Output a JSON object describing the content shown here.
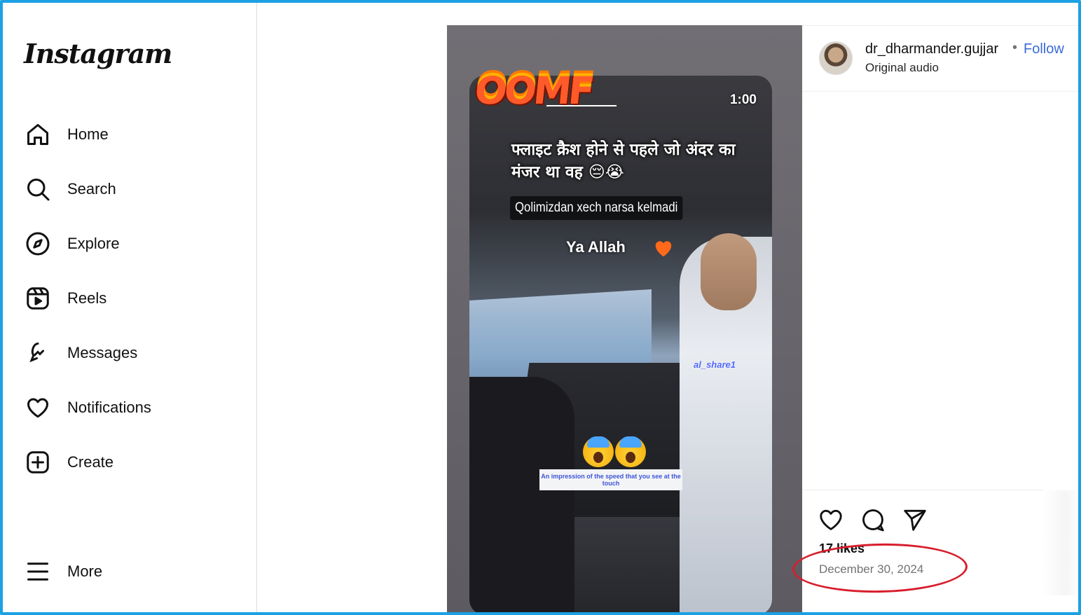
{
  "app": {
    "logo_text": "Instagram"
  },
  "sidebar": {
    "items": [
      {
        "label": "Home",
        "icon": "home-icon"
      },
      {
        "label": "Search",
        "icon": "search-icon"
      },
      {
        "label": "Explore",
        "icon": "compass-icon"
      },
      {
        "label": "Reels",
        "icon": "reels-icon"
      },
      {
        "label": "Messages",
        "icon": "messenger-icon"
      },
      {
        "label": "Notifications",
        "icon": "heart-icon"
      },
      {
        "label": "Create",
        "icon": "plus-square-icon"
      },
      {
        "label": "More",
        "icon": "hamburger-icon"
      }
    ]
  },
  "post": {
    "media": {
      "duration": "1:00",
      "hindi_overlay": "फ्लाइट क्रैश होने से पहले जो अंदर का मंजर था वह 😔😭",
      "uzbek_caption": "Qolimizdan xech narsa kelmadi",
      "ya_allah": "Ya Allah",
      "watermark": "al_share1",
      "impression_text": "An impression of the speed that you see at the touch",
      "badge_text": "OOMF"
    },
    "author": {
      "username": "dr_dharmander.gujjar",
      "separator": "•",
      "follow_label": "Follow",
      "audio": "Original audio"
    },
    "likes": "17 likes",
    "date": "December 30, 2024"
  },
  "colors": {
    "accent": "#3a6bd6",
    "annotation": "#d81e2c",
    "frame": "#1ba1e2"
  }
}
